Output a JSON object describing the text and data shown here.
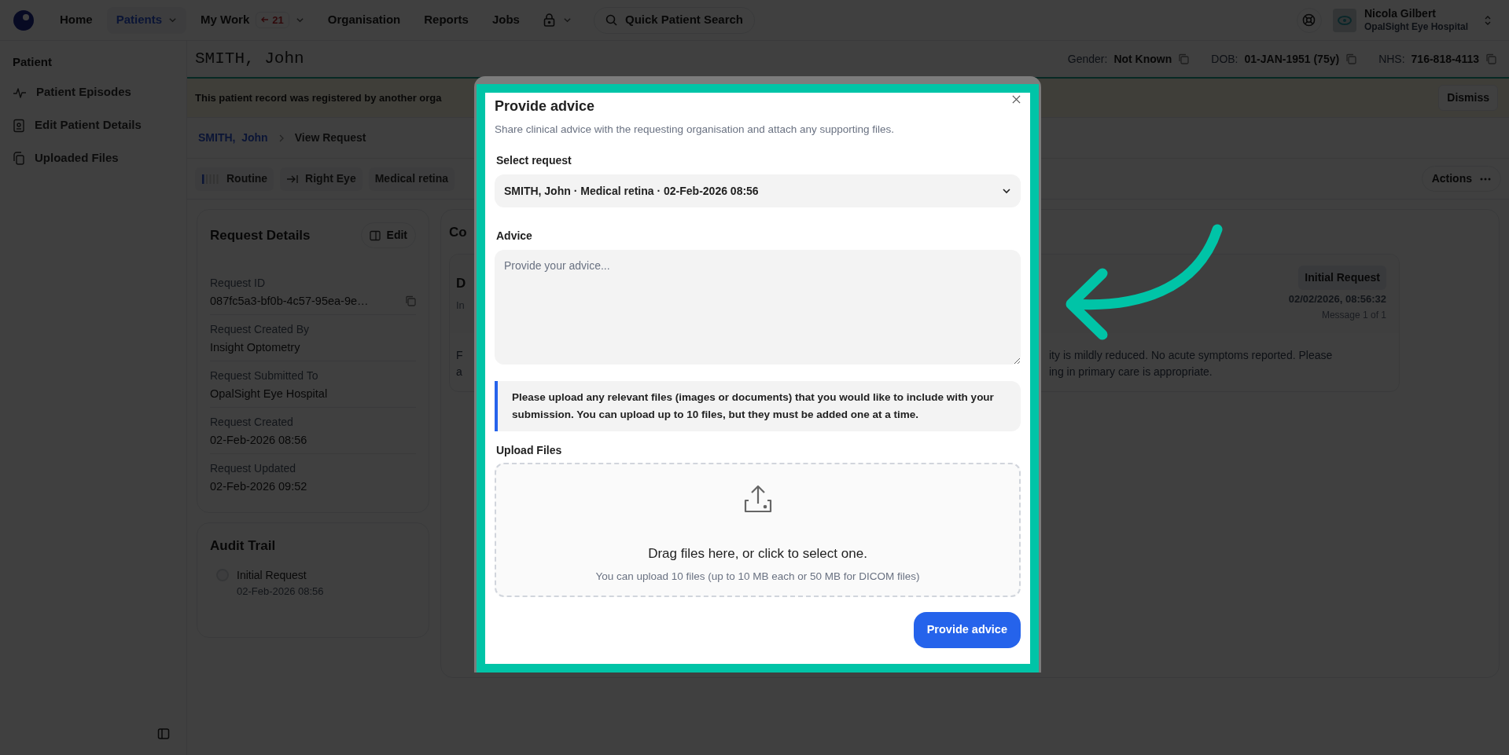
{
  "nav": {
    "items": [
      {
        "label": "Home",
        "selected": false,
        "has_menu": false
      },
      {
        "label": "Patients",
        "selected": true,
        "has_menu": true
      },
      {
        "label": "My Work",
        "selected": false,
        "has_menu": true,
        "badge": "21"
      },
      {
        "label": "Organisation",
        "selected": false,
        "has_menu": false
      },
      {
        "label": "Reports",
        "selected": false,
        "has_menu": false
      },
      {
        "label": "Jobs",
        "selected": false,
        "has_menu": false
      }
    ],
    "search_button": "Quick Patient Search"
  },
  "user": {
    "name": "Nicola Gilbert",
    "organisation": "OpalSight Eye Hospital"
  },
  "sidebar": {
    "heading": "Patient",
    "items": [
      {
        "label": "Patient Episodes"
      },
      {
        "label": "Edit Patient Details"
      },
      {
        "label": "Uploaded Files"
      }
    ]
  },
  "patient_header": {
    "name": "SMITH, John",
    "fields": [
      {
        "label": "Gender:",
        "value": "Not Known"
      },
      {
        "label": "DOB:",
        "value": "01-JAN-1951 (75y)"
      },
      {
        "label": "NHS:",
        "value": "716-818-4113"
      }
    ]
  },
  "banner": {
    "message": "This patient record was registered by another orga",
    "dismiss": "Dismiss"
  },
  "breadcrumb": [
    {
      "label": "SMITH,  John",
      "kind": "link"
    },
    {
      "label": "View Request",
      "kind": "current"
    }
  ],
  "tags": [
    {
      "label": "Routine",
      "kind": "priority"
    },
    {
      "label": "Right Eye",
      "kind": "eye"
    },
    {
      "label": "Medical retina",
      "kind": "plain"
    }
  ],
  "actions": "Actions",
  "request_details": {
    "title": "Request Details",
    "edit": "Edit",
    "fields": [
      {
        "label": "Request ID",
        "value": "087fc5a3-bf0b-4c57-95ea-9e…",
        "copyable": true
      },
      {
        "label": "Request Created By",
        "value": "Insight Optometry",
        "copyable": false
      },
      {
        "label": "Request Submitted To",
        "value": "OpalSight Eye Hospital",
        "copyable": false
      },
      {
        "label": "Request Created",
        "value": "02-Feb-2026 08:56",
        "copyable": false
      },
      {
        "label": "Request Updated",
        "value": "02-Feb-2026 09:52",
        "copyable": false
      }
    ]
  },
  "audit_trail": {
    "title": "Audit Trail",
    "events": [
      {
        "title": "Initial Request",
        "time": "02-Feb-2026 08:56"
      }
    ]
  },
  "conversation": {
    "title": "Co",
    "message": {
      "title": "D",
      "subtitle": "In",
      "badge": "Initial Request",
      "timestamp": "02/02/2026, 08:56:32",
      "counter": "Message 1 of 1",
      "body_left": [
        "F",
        "a"
      ],
      "body_right": [
        "ity is mildly reduced. No acute symptoms reported. Please",
        "ing in primary care is appropriate."
      ]
    }
  },
  "modal": {
    "title": "Provide advice",
    "description": "Share clinical advice with the requesting organisation and attach any supporting files.",
    "select": {
      "label": "Select request",
      "value": "SMITH, John · Medical retina · 02-Feb-2026 08:56"
    },
    "advice": {
      "label": "Advice",
      "placeholder": "Provide your advice..."
    },
    "notice": "Please upload any relevant files (images or documents) that you would like to include with your submission. You can upload up to 10 files, but they must be added one at a time.",
    "upload": {
      "label": "Upload Files",
      "prompt": "Drag files here, or click to select one.",
      "hint": "You can upload 10 files (up to 10 MB each or 50 MB for DICOM files)"
    },
    "submit": "Provide advice"
  }
}
